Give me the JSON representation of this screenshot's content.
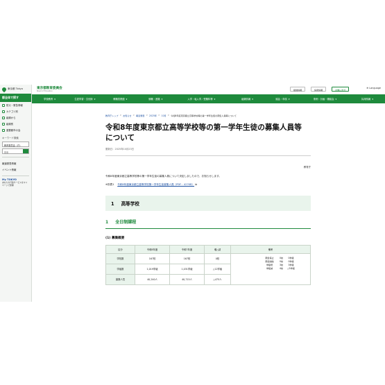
{
  "sidebar": {
    "logo": "東京都 Tokyo",
    "heading": "都全体で探す",
    "items": [
      {
        "label": "防災・緊急情報"
      },
      {
        "label": "カテゴリ別"
      },
      {
        "label": "組織から"
      },
      {
        "label": "組織別"
      },
      {
        "label": "重要都市の会"
      }
    ],
    "keyword_label": "キーワード検索",
    "select_value": "教育委員会（庁）",
    "search_placeholder": "検索",
    "links": [
      {
        "label": "報道発表情報"
      },
      {
        "label": "イベント情報"
      }
    ],
    "mytokyo_title": "My TOKYO",
    "mytokyo_desc": "あなたの行政サービスをマイページで整理"
  },
  "header": {
    "org_name": "東京都教育委員会",
    "org_sub": "Board of Education",
    "buttons": [
      "組織情報",
      "採用情報",
      "お問い合せ"
    ],
    "language": "Language"
  },
  "gnav": [
    "学校教育",
    "生涯学習・文化財",
    "教職員関連",
    "就職・進路",
    "入学・転入学／受験料等",
    "組織情報",
    "議会・申請",
    "条例・計画・審議会",
    "採用情報"
  ],
  "breadcrumbs": [
    "教育庁トップ",
    "お知らせ",
    "報道発表",
    "2025年",
    "10月",
    "令和8年度東京都立高等学校等の第一学年生徒の募集人員等について"
  ],
  "page": {
    "title": "令和8年度東京都立高等学校等の第一学年生徒の募集人員等について",
    "updated": "更新日：2025年10月23日",
    "department": "教育庁",
    "lead": "令和8年度東京都立高等学校等の第一学年生徒の募集人員について決定しましたので、お知らせします。",
    "ref_prefix": "※別表1",
    "ref_link": "令和8年度東京都立高等学校第一学年生徒募集人員（PDF：427KB）",
    "h2_num": "1",
    "h2_text": "高等学校",
    "h3_num": "1",
    "h3_text": "全日制課程",
    "h4": "(1) 募集概要"
  },
  "table": {
    "headers": [
      "区分",
      "令和8年度",
      "令和7年度",
      "増△減",
      "備考"
    ],
    "rows": [
      {
        "label": "学校数",
        "r8": "167校",
        "r7": "167校",
        "diff": "0校"
      },
      {
        "label": "学級数",
        "r8": "1,019学級",
        "r7": "1,031学級",
        "diff": "△12学級"
      },
      {
        "label": "募集人員",
        "r8": "40,240人",
        "r7": "40,715人",
        "diff": "△475人"
      }
    ],
    "notes": [
      {
        "k": "募集停止",
        "a": "0校",
        "b": "0学級"
      },
      {
        "k": "募集開始",
        "a": "0校",
        "b": "0学級"
      },
      {
        "k": "学級増",
        "a": "3校",
        "b": "3学級"
      },
      {
        "k": "学級減",
        "a": "4校",
        "b": "△5学級"
      }
    ]
  }
}
